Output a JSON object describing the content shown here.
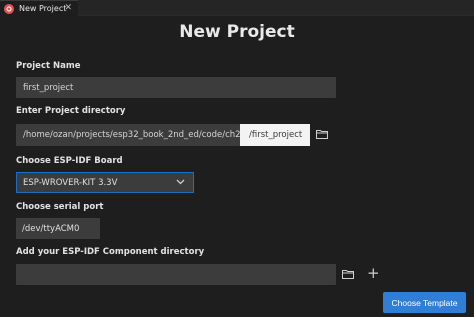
{
  "tab": {
    "title": "New Project",
    "close": "✕"
  },
  "page": {
    "title": "New Project"
  },
  "form": {
    "project_name": {
      "label": "Project Name",
      "value": "first_project"
    },
    "project_directory": {
      "label": "Enter Project directory",
      "value": "/home/ozan/projects/esp32_book_2nd_ed/code/ch2",
      "suffix": "/first_project"
    },
    "board": {
      "label": "Choose ESP-IDF Board",
      "value": "ESP-WROVER-KIT 3.3V"
    },
    "serial_port": {
      "label": "Choose serial port",
      "value": "/dev/ttyACM0"
    },
    "component_directory": {
      "label": "Add your ESP-IDF Component directory",
      "value": "",
      "add": "+"
    }
  },
  "actions": {
    "choose_template": "Choose Template"
  },
  "colors": {
    "accent": "#2f7fd8",
    "background": "#1e1e1e",
    "input": "#3c3c3c",
    "tab_icon": "#e05656"
  },
  "icons": [
    "espressif-icon",
    "close-icon",
    "folder-icon",
    "chevron-down-icon",
    "plus-icon"
  ]
}
